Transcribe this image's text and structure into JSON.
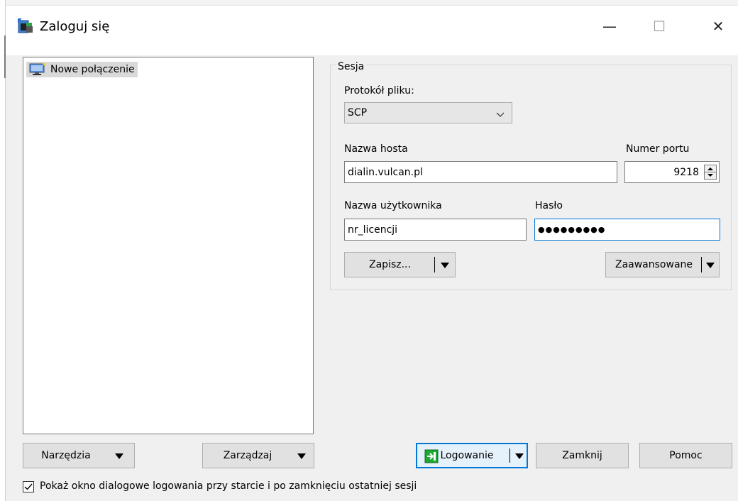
{
  "window": {
    "title": "Zaloguj się",
    "controls": {
      "minimize": "—",
      "maximize": "☐",
      "close": "✕"
    }
  },
  "sessions": {
    "items": [
      {
        "label": "Nowe połączenie",
        "icon": "monitor-icon"
      }
    ]
  },
  "session_group": {
    "label": "Sesja",
    "protocol": {
      "label": "Protokół pliku:",
      "value": "SCP"
    },
    "host": {
      "label": "Nazwa hosta",
      "value": "dialin.vulcan.pl"
    },
    "port": {
      "label": "Numer portu",
      "value": "9218"
    },
    "username": {
      "label": "Nazwa użytkownika",
      "value": "nr_licencji"
    },
    "password": {
      "label": "Hasło",
      "value": "●●●●●●●●●"
    },
    "save_button": "Zapisz...",
    "advanced_button": "Zaawansowane"
  },
  "bottom": {
    "tools_button": "Narzędzia",
    "manage_button": "Zarządzaj",
    "login_button": "Logowanie",
    "close_button": "Zamknij",
    "help_button": "Pomoc",
    "show_dialog_checkbox": {
      "label": "Pokaż okno dialogowe logowania przy starcie i po zamknięciu ostatniej sesji",
      "checked": true
    }
  },
  "colors": {
    "accent": "#0078d7",
    "login_icon": "#1fa832",
    "background": "#f0f0f0"
  }
}
